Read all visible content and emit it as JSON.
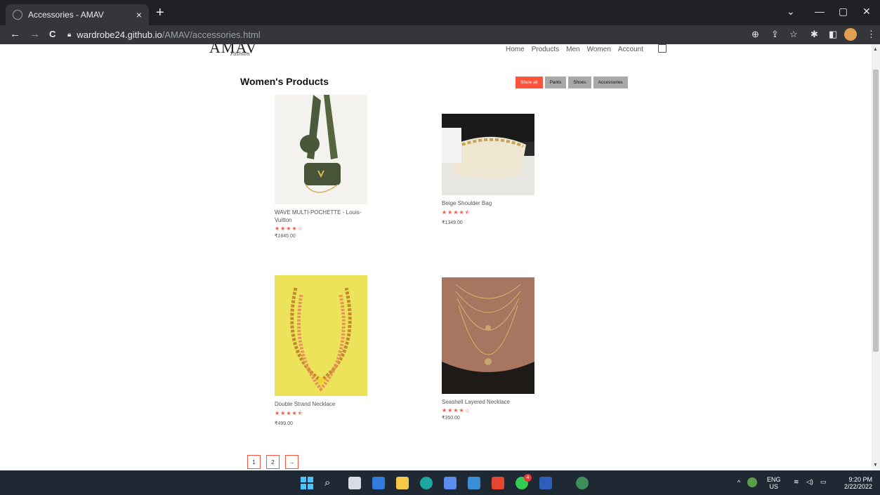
{
  "browser": {
    "tab_title": "Accessories - AMAV",
    "tab_close": "×",
    "new_tab": "+",
    "url_host": "wardrobe24.github.io",
    "url_path": "/AMAV/accessories.html",
    "back": "←",
    "forward": "→",
    "reload": "C"
  },
  "site": {
    "logo": "AMAV",
    "logo_sub": "Fashion",
    "nav": [
      "Home",
      "Products",
      "Men",
      "Women",
      "Account"
    ]
  },
  "section": {
    "title": "Women's Products",
    "filters": [
      "Show all",
      "Pants",
      "Shoes",
      "Accessories"
    ],
    "active_filter": "Show all"
  },
  "products": [
    {
      "name": "WAVE MULTI-POCHETTE - Louis-Vuitton",
      "stars": "★★★★☆",
      "price": "₹1845.00"
    },
    {
      "name": "Beige Shoulder Bag",
      "stars": "★★★★⯪",
      "price": "₹1349.00"
    },
    {
      "name": "Double Strand Necklace",
      "stars": "★★★★⯪",
      "price": "₹499.00"
    },
    {
      "name": "Seashell Layered Necklace",
      "stars": "★★★★☆",
      "price": "₹350.00"
    }
  ],
  "pagination": [
    "1",
    "2",
    "→"
  ],
  "taskbar": {
    "lang_top": "ENG",
    "lang_bottom": "US",
    "time": "9:20 PM",
    "date": "2/22/2022",
    "whatsapp_badge": "4"
  },
  "colors": {
    "accent": "#ff523b",
    "chrome": "#202124",
    "taskbar": "#1f2933"
  }
}
